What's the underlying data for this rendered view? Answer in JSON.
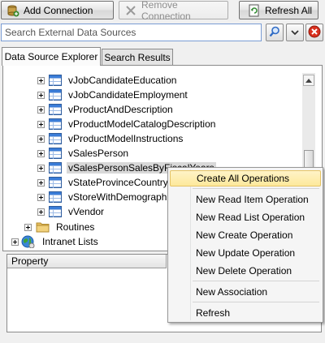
{
  "toolbar": {
    "add_connection": "Add Connection",
    "remove_connection": "Remove Connection",
    "refresh_all": "Refresh All"
  },
  "search": {
    "placeholder": "Search External Data Sources"
  },
  "tabs": {
    "explorer": "Data Source Explorer",
    "results": "Search Results"
  },
  "tree": {
    "views": [
      "vJobCandidateEducation",
      "vJobCandidateEmployment",
      "vProductAndDescription",
      "vProductModelCatalogDescription",
      "vProductModelInstructions",
      "vSalesPerson",
      "vSalesPersonSalesByFiscalYears",
      "vStateProvinceCountryR",
      "vStoreWithDemographi",
      "vVendor"
    ],
    "routines": "Routines",
    "intranet": "Intranet Lists"
  },
  "properties": {
    "header": "Property"
  },
  "context_menu": {
    "create_all": "Create All Operations",
    "read_item": "New Read Item Operation",
    "read_list": "New Read List Operation",
    "create": "New Create Operation",
    "update": "New Update Operation",
    "delete": "New Delete Operation",
    "association": "New Association",
    "refresh": "Refresh"
  },
  "colors": {
    "highlight": "#fde99b",
    "close_red": "#d9301e",
    "accent_blue": "#2f6bc5"
  }
}
